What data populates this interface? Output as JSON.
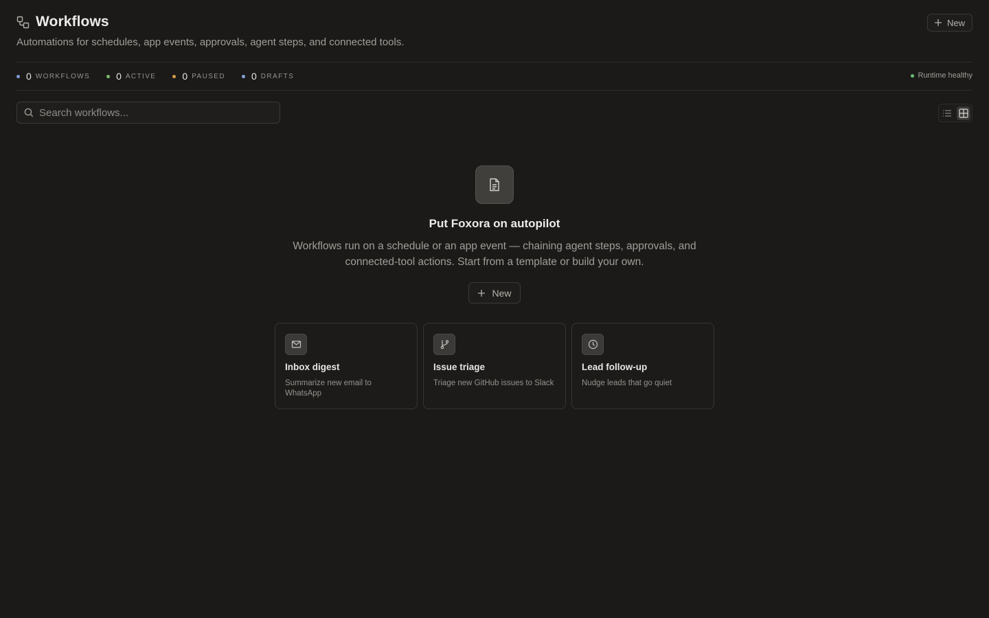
{
  "header": {
    "title": "Workflows",
    "subtitle": "Automations for schedules, app events, approvals, agent steps, and connected tools.",
    "new_label": "New",
    "title_icon": "workflow-icon"
  },
  "stats": [
    {
      "count": "0",
      "label": "WORKFLOWS",
      "color": "#7f9bd6"
    },
    {
      "count": "0",
      "label": "ACTIVE",
      "color": "#7dbb6a"
    },
    {
      "count": "0",
      "label": "PAUSED",
      "color": "#d59a4a"
    },
    {
      "count": "0",
      "label": "DRAFTS",
      "color": "#8aa0d8"
    }
  ],
  "runtime": {
    "label": "Runtime healthy",
    "color": "#6bbf73"
  },
  "search": {
    "placeholder": "Search workflows...",
    "value": ""
  },
  "view_toggle": {
    "list_icon": "list-view-icon",
    "grid_icon": "grid-view-icon",
    "active": "grid"
  },
  "empty_state": {
    "icon": "document-icon",
    "title": "Put Foxora on autopilot",
    "description": "Workflows run on a schedule or an app event — chaining agent steps, approvals, and connected-tool actions. Start from a template or build your own.",
    "new_label": "New"
  },
  "templates": [
    {
      "icon": "mail-icon",
      "title": "Inbox digest",
      "description": "Summarize new email to WhatsApp"
    },
    {
      "icon": "git-branch-icon",
      "title": "Issue triage",
      "description": "Triage new GitHub issues to Slack"
    },
    {
      "icon": "clock-icon",
      "title": "Lead follow-up",
      "description": "Nudge leads that go quiet"
    }
  ]
}
